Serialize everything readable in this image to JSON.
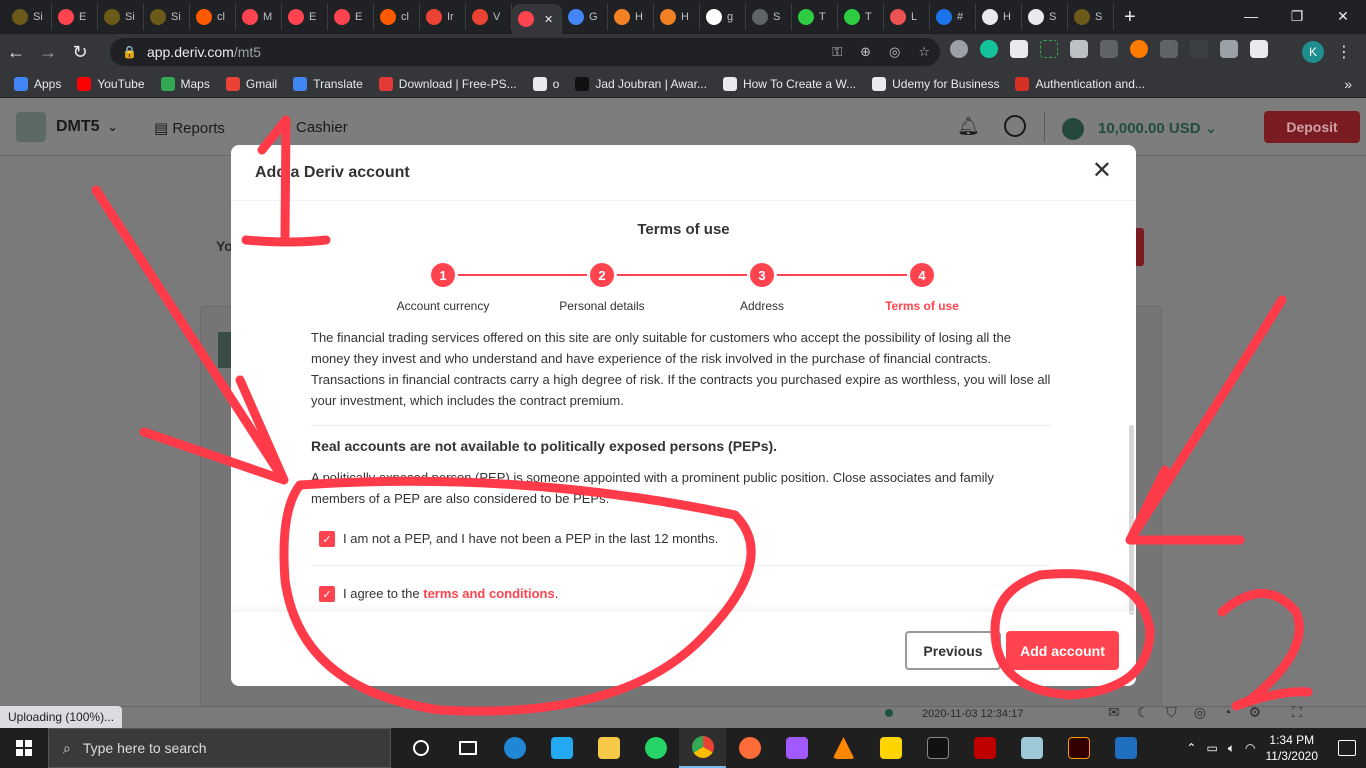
{
  "browser": {
    "tabs": [
      {
        "label": "Si",
        "icon": "sv-icon",
        "color": "#6b5a1a"
      },
      {
        "label": "E",
        "icon": "deriv-icon",
        "color": "#ff444f"
      },
      {
        "label": "Si",
        "icon": "sv-icon",
        "color": "#6b5a1a"
      },
      {
        "label": "Si",
        "icon": "sv-icon",
        "color": "#6b5a1a"
      },
      {
        "label": "cl",
        "icon": "cp-icon",
        "color": "#ff5a00"
      },
      {
        "label": "M",
        "icon": "deriv-d-icon",
        "color": "#ff444f"
      },
      {
        "label": "E",
        "icon": "deriv-icon",
        "color": "#ff444f"
      },
      {
        "label": "E",
        "icon": "deriv-icon",
        "color": "#ff444f"
      },
      {
        "label": "cl",
        "icon": "cp-icon",
        "color": "#ff5a00"
      },
      {
        "label": "Ir",
        "icon": "gmail-icon",
        "color": "#ea4335"
      },
      {
        "label": "V",
        "icon": "gmail-icon",
        "color": "#ea4335"
      },
      {
        "label": "",
        "icon": "deriv-d-icon",
        "color": "#ff444f",
        "active": true
      },
      {
        "label": "G",
        "icon": "google-icon",
        "color": "#4285f4"
      },
      {
        "label": "H",
        "icon": "stack-icon",
        "color": "#f48024"
      },
      {
        "label": "H",
        "icon": "stack-icon",
        "color": "#f48024"
      },
      {
        "label": "g",
        "icon": "github-icon",
        "color": "#ffffff"
      },
      {
        "label": "S",
        "icon": "s-icon",
        "color": "#5f6368"
      },
      {
        "label": "T",
        "icon": "cc-icon",
        "color": "#2ecc40"
      },
      {
        "label": "T",
        "icon": "cc-icon",
        "color": "#2ecc40"
      },
      {
        "label": "L",
        "icon": "udemy-icon",
        "color": "#ec5252"
      },
      {
        "label": "#",
        "icon": "calendar-icon",
        "color": "#1a73e8"
      },
      {
        "label": "H",
        "icon": "history-icon",
        "color": "#e8eaed"
      },
      {
        "label": "S",
        "icon": "gear-icon",
        "color": "#e8eaed"
      },
      {
        "label": "S",
        "icon": "sv-icon",
        "color": "#6b5a1a"
      }
    ],
    "active_tab_close": "✕",
    "new_tab": "+",
    "url_host": "app.deriv.com",
    "url_path": "/mt5",
    "avatar_letter": "K",
    "bookmarks": [
      {
        "label": "Apps",
        "color": "#4285f4"
      },
      {
        "label": "YouTube",
        "color": "#ff0000"
      },
      {
        "label": "Maps",
        "color": "#34a853"
      },
      {
        "label": "Gmail",
        "color": "#ea4335"
      },
      {
        "label": "Translate",
        "color": "#4285f4"
      },
      {
        "label": "Download | Free-PS...",
        "color": "#e53935"
      },
      {
        "label": "o",
        "color": "#e8eaed"
      },
      {
        "label": "Jad Joubran | Awar...",
        "color": "#111111"
      },
      {
        "label": "How To Create a W...",
        "color": "#e8eaed"
      },
      {
        "label": "Udemy for Business",
        "color": "#e8eaed"
      },
      {
        "label": "Authentication and...",
        "color": "#d93025"
      }
    ],
    "bookmarks_more": "»"
  },
  "app": {
    "product": "DMT5",
    "nav_reports": "Reports",
    "nav_cashier": "Cashier",
    "balance": "10,000.00 USD",
    "deposit": "Deposit",
    "bg_text": "Yo",
    "status_timestamp": "2020-11-03 12:34:17"
  },
  "modal": {
    "title": "Add a Deriv account",
    "close": "✕",
    "section_title": "Terms of use",
    "steps": [
      {
        "num": "1",
        "label": "Account currency"
      },
      {
        "num": "2",
        "label": "Personal details"
      },
      {
        "num": "3",
        "label": "Address"
      },
      {
        "num": "4",
        "label": "Terms of use"
      }
    ],
    "disclaimer": "The financial trading services offered on this site are only suitable for customers who accept the possibility of losing all the money they invest and who understand and have experience of the risk involved in the purchase of financial contracts. Transactions in financial contracts carry a high degree of risk. If the contracts you purchased expire as worthless, you will lose all your investment, which includes the contract premium.",
    "pep_heading": "Real accounts are not available to politically exposed persons (PEPs).",
    "pep_body": "A politically exposed person (PEP) is someone appointed with a prominent public position. Close associates and family members of a PEP are also considered to be PEPs.",
    "check_pep": "I am not a PEP, and I have not been a PEP in the last 12 months.",
    "check_terms_prefix": "I agree to the ",
    "check_terms_link": "terms and conditions",
    "check_terms_suffix": ".",
    "btn_previous": "Previous",
    "btn_add": "Add account"
  },
  "status_bar": {
    "upload": "Uploading (100%)..."
  },
  "taskbar": {
    "search_placeholder": "Type here to search",
    "time": "1:34 PM",
    "date": "11/3/2020"
  }
}
